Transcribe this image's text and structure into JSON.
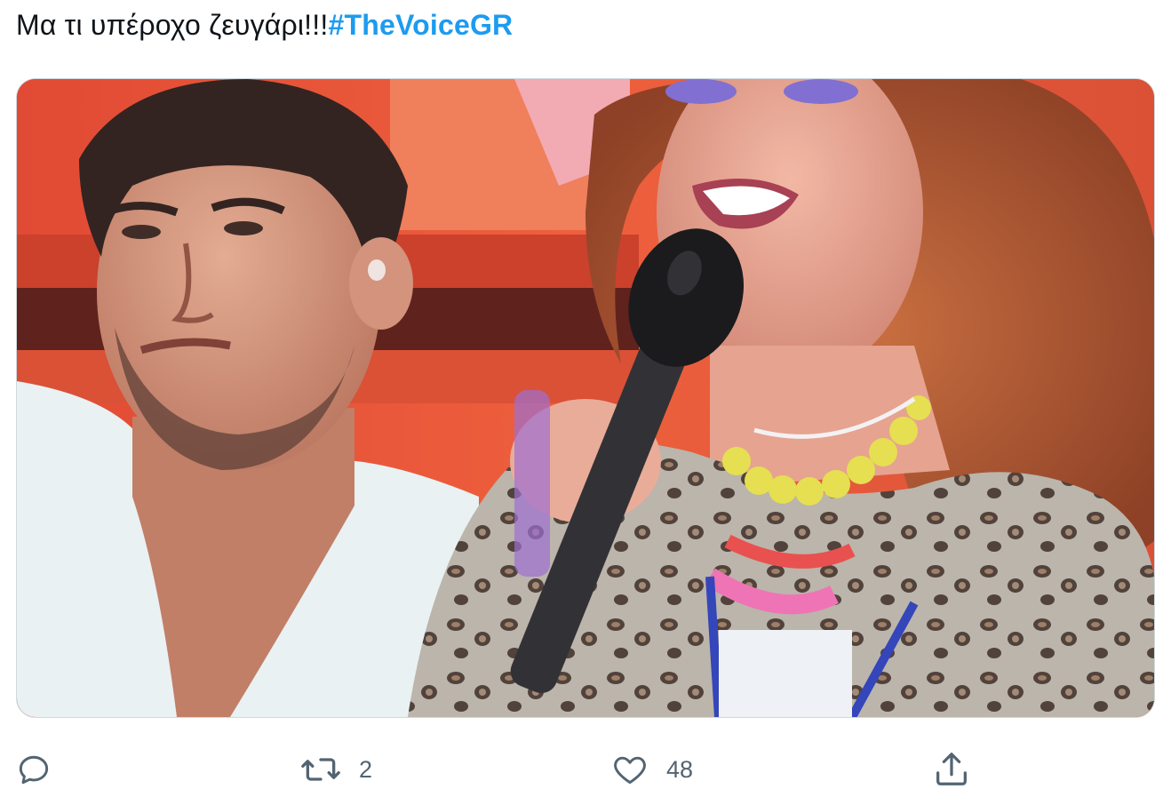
{
  "tweet": {
    "text": "Μα τι υπέροχο ζευγάρι!!!",
    "hashtag": "#TheVoiceGR",
    "hashtag_color": "#1d9bf0"
  },
  "media": {
    "alt": "photo"
  },
  "actions": {
    "reply": {
      "icon": "reply-icon",
      "count": ""
    },
    "retweet": {
      "icon": "retweet-icon",
      "count": "2"
    },
    "like": {
      "icon": "heart-icon",
      "count": "48"
    },
    "share": {
      "icon": "share-icon"
    }
  },
  "colors": {
    "icon_gray": "#536471",
    "media_border": "#cfd9de"
  }
}
